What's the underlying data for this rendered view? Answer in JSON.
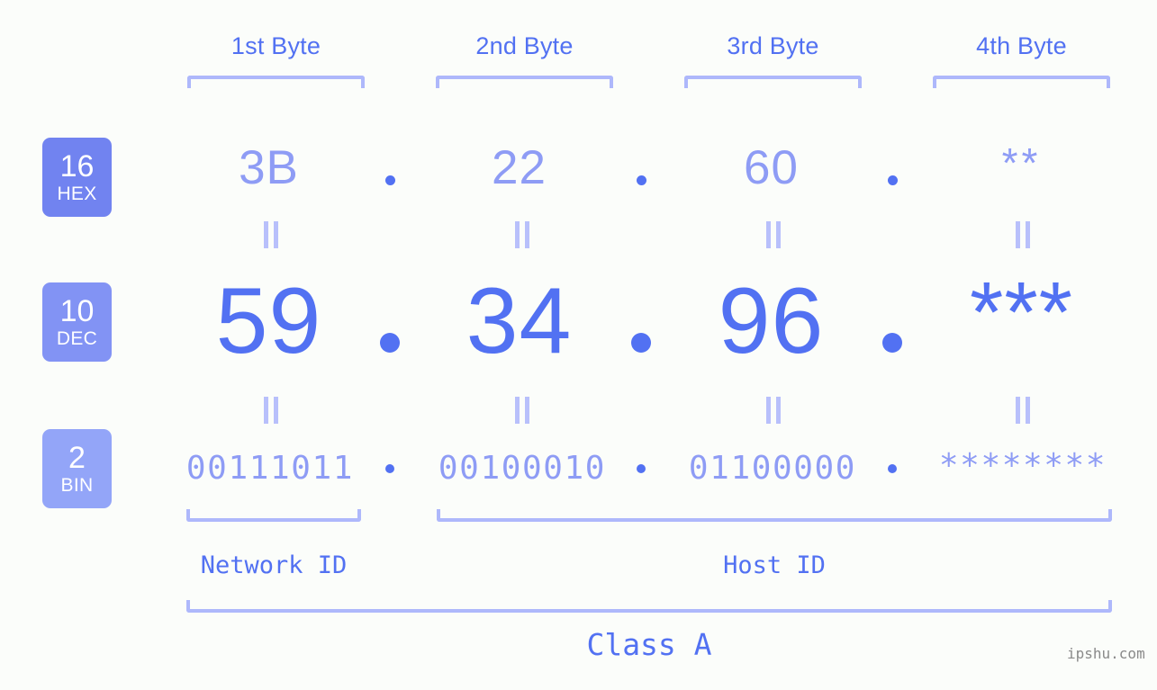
{
  "meta": {
    "watermark": "ipshu.com",
    "background_color": "#fbfdfa",
    "accent_color": "#5271f2",
    "light_accent_color": "#8e9cf5",
    "bracket_color": "#aeb8fb"
  },
  "byte_headers": [
    {
      "label": "1st Byte"
    },
    {
      "label": "2nd Byte"
    },
    {
      "label": "3rd Byte"
    },
    {
      "label": "4th Byte"
    }
  ],
  "bases": [
    {
      "number": "16",
      "name": "HEX",
      "color": "#7183f0"
    },
    {
      "number": "10",
      "name": "DEC",
      "color": "#8293f4"
    },
    {
      "number": "2",
      "name": "BIN",
      "color": "#93a5f8"
    }
  ],
  "rows": {
    "hex": {
      "base_number": "16",
      "base_name": "HEX",
      "values": [
        "3B",
        "22",
        "60",
        "**"
      ],
      "separator": "."
    },
    "dec": {
      "base_number": "10",
      "base_name": "DEC",
      "values": [
        "59",
        "34",
        "96",
        "***"
      ],
      "separator": "."
    },
    "bin": {
      "base_number": "2",
      "base_name": "BIN",
      "values": [
        "00111011",
        "00100010",
        "01100000",
        "********"
      ],
      "separator": "."
    }
  },
  "equality_symbol": "||",
  "footer": {
    "network_id_label": "Network ID",
    "host_id_label": "Host ID",
    "class_label": "Class A"
  }
}
